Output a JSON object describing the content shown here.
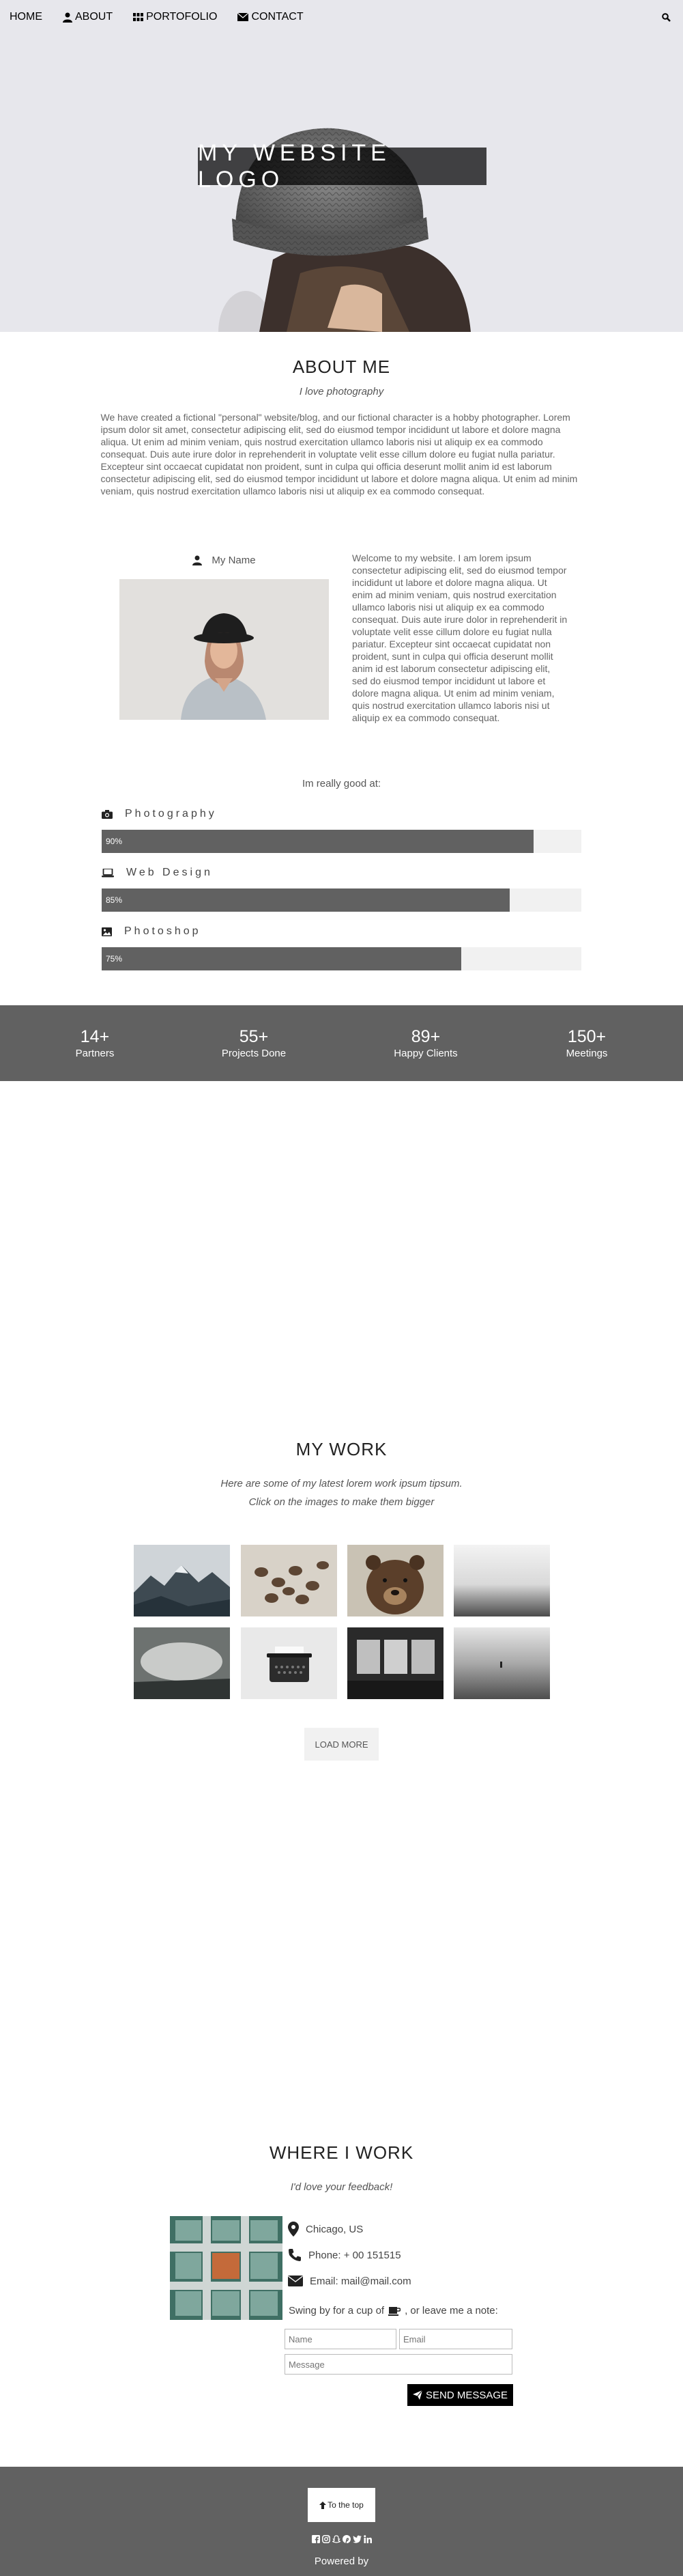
{
  "nav": {
    "home": "HOME",
    "about": "ABOUT",
    "portfolio": "PORTOFOLIO",
    "contact": "CONTACT"
  },
  "hero": {
    "logo": "MY WEBSITE LOGO"
  },
  "about": {
    "title": "ABOUT ME",
    "subtitle": "I love photography",
    "text": "We have created a fictional \"personal\" website/blog, and our fictional character is a hobby photographer. Lorem ipsum dolor sit amet, consectetur adipiscing elit, sed do eiusmod tempor incididunt ut labore et dolore magna aliqua. Ut enim ad minim veniam, quis nostrud exercitation ullamco laboris nisi ut aliquip ex ea commodo consequat. Duis aute irure dolor in reprehenderit in voluptate velit esse cillum dolore eu fugiat nulla pariatur. Excepteur sint occaecat cupidatat non proident, sunt in culpa qui officia deserunt mollit anim id est laborum consectetur adipiscing elit, sed do eiusmod tempor incididunt ut labore et dolore magna aliqua. Ut enim ad minim veniam, quis nostrud exercitation ullamco laboris nisi ut aliquip ex ea commodo consequat."
  },
  "profile": {
    "name": "My Name",
    "text": "Welcome to my website. I am lorem ipsum consectetur adipiscing elit, sed do eiusmod tempor incididunt ut labore et dolore magna aliqua. Ut enim ad minim veniam, quis nostrud exercitation ullamco laboris nisi ut aliquip ex ea commodo consequat. Duis aute irure dolor in reprehenderit in voluptate velit esse cillum dolore eu fugiat nulla pariatur. Excepteur sint occaecat cupidatat non proident, sunt in culpa qui officia deserunt mollit anim id est laborum consectetur adipiscing elit, sed do eiusmod tempor incididunt ut labore et dolore magna aliqua. Ut enim ad minim veniam, quis nostrud exercitation ullamco laboris nisi ut aliquip ex ea commodo consequat."
  },
  "skills": {
    "heading": "Im really good at:",
    "items": [
      {
        "label": "Photography",
        "percent_label": "90%",
        "percent": 90,
        "icon": "camera-icon"
      },
      {
        "label": "Web Design",
        "percent_label": "85%",
        "percent": 85,
        "icon": "laptop-icon"
      },
      {
        "label": "Photoshop",
        "percent_label": "75%",
        "percent": 75,
        "icon": "image-icon"
      }
    ]
  },
  "stats": [
    {
      "number": "14+",
      "label": "Partners"
    },
    {
      "number": "55+",
      "label": "Projects Done"
    },
    {
      "number": "89+",
      "label": "Happy Clients"
    },
    {
      "number": "150+",
      "label": "Meetings"
    }
  ],
  "work": {
    "title": "MY WORK",
    "subtitle1": "Here are some of my latest lorem work ipsum tipsum.",
    "subtitle2": "Click on the images to make them bigger",
    "load_more": "LOAD MORE"
  },
  "where": {
    "title": "WHERE I WORK",
    "subtitle": "I'd love your feedback!",
    "location": "Chicago, US",
    "phone": "Phone: + 00 151515",
    "email": "Email: mail@mail.com",
    "swing_before": "Swing by for a cup of",
    "swing_after": ", or leave me a note:",
    "name_placeholder": "Name",
    "email_placeholder": "Email",
    "message_placeholder": "Message",
    "send": "SEND MESSAGE"
  },
  "footer": {
    "to_top": "To the top",
    "powered": "Powered by",
    "social_icons": [
      "facebook-icon",
      "instagram-icon",
      "snapchat-icon",
      "pinterest-icon",
      "twitter-icon",
      "linkedin-icon"
    ]
  },
  "colors": {
    "dark_band": "#616161",
    "bar_track": "#f1f1f1",
    "accent_black": "#000000"
  }
}
